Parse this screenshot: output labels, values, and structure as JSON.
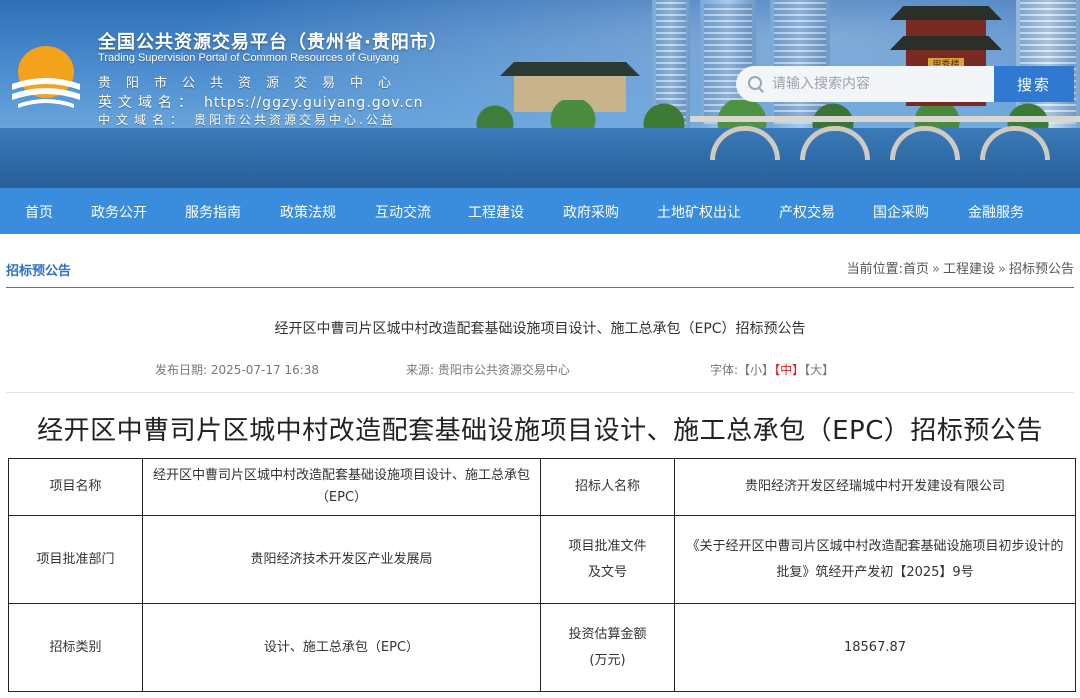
{
  "header": {
    "brand_cn": "全国公共资源交易平台（贵州省·贵阳市）",
    "brand_en": "Trading Supervision Portal of Common Resources of Guiyang",
    "line1": "贵阳市公共资源交易中心",
    "domain_en_label": "英文域名：",
    "domain_en_value": "https://ggzy.guiyang.gov.cn",
    "domain_cn_label": "中文域名：",
    "domain_cn_value": "贵阳市公共资源交易中心.公益",
    "pavilion_sign": "甲秀楼",
    "search": {
      "placeholder": "请输入搜索内容",
      "button": "搜索"
    }
  },
  "nav": {
    "items": [
      "首页",
      "政务公开",
      "服务指南",
      "政策法规",
      "互动交流",
      "工程建设",
      "政府采购",
      "土地矿权出让",
      "产权交易",
      "国企采购",
      "金融服务"
    ]
  },
  "section": {
    "title": "招标预公告",
    "crumb_prefix": "当前位置:",
    "crumbs": [
      "首页",
      "工程建设",
      "招标预公告"
    ],
    "separator": "»"
  },
  "article": {
    "title": "经开区中曹司片区城中村改造配套基础设施项目设计、施工总承包（EPC）招标预公告",
    "publish_label": "发布日期:",
    "publish_value": "2025-07-17 16:38",
    "source_label": "来源:",
    "source_value": "贵阳市公共资源交易中心",
    "font_label": "字体:",
    "font_small": "【小】",
    "font_mid": "【中】",
    "font_large": "【大】",
    "big_title": "经开区中曹司片区城中村改造配套基础设施项目设计、施工总承包（EPC）招标预公告"
  },
  "table": {
    "rows": [
      {
        "l1": "项目名称",
        "v1": "经开区中曹司片区城中村改造配套基础设施项目设计、施工总承包（EPC）",
        "l2": "招标人名称",
        "v2": "贵阳经济开发区经瑞城中村开发建设有限公司"
      },
      {
        "l1": "项目批准部门",
        "v1": "贵阳经济技术开发区产业发展局",
        "l2": "项目批准文件及文号",
        "v2": "《关于经开区中曹司片区城中村改造配套基础设施项目初步设计的批复》筑经开产发初【2025】9号"
      },
      {
        "l1": "招标类别",
        "v1": "设计、施工总承包（EPC）",
        "l2": "投资估算金额(万元)",
        "v2": "18567.87"
      }
    ]
  },
  "colors": {
    "nav_bg": "#3a8ddc",
    "accent": "#2e72c4",
    "font_mid_active": "#dd2222"
  }
}
